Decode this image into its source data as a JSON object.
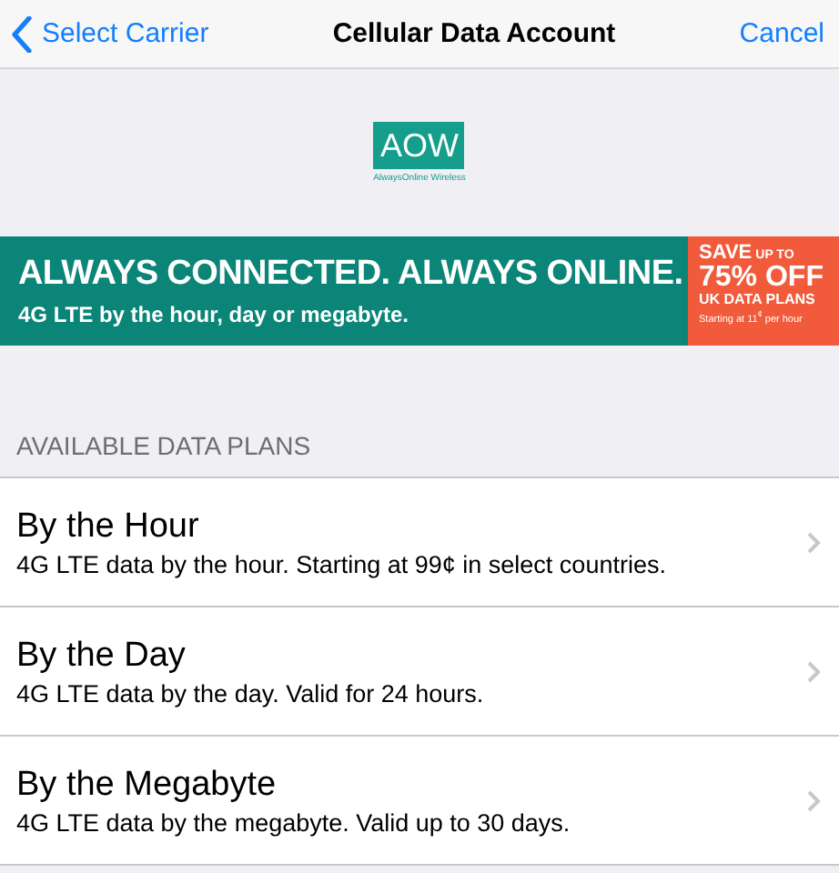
{
  "nav": {
    "back": "Select Carrier",
    "title": "Cellular Data Account",
    "action": "Cancel"
  },
  "logo": {
    "mark": "AOW",
    "caption": "AlwaysOnline Wireless"
  },
  "banner": {
    "headline": "ALWAYS CONNECTED. ALWAYS ONLINE.",
    "subline": "4G LTE by the hour, day or megabyte.",
    "promo": {
      "save": "SAVE",
      "upto": "UP TO",
      "discount": "75% OFF",
      "plans": "UK DATA PLANS",
      "starting": "Starting at 11$^{¢}$ per hour"
    }
  },
  "section_header": "AVAILABLE DATA PLANS",
  "plans": [
    {
      "title": "By the Hour",
      "detail": "4G LTE data by the hour. Starting at 99¢ in select countries."
    },
    {
      "title": "By the Day",
      "detail": "4G LTE data by the day. Valid for 24 hours."
    },
    {
      "title": "By the Megabyte",
      "detail": "4G LTE data by the megabyte. Valid up to 30 days."
    }
  ]
}
